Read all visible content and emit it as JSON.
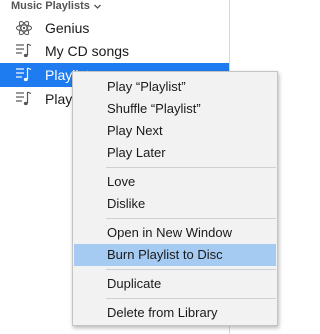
{
  "sidebar": {
    "section_title": "Music Playlists",
    "items": [
      {
        "label": "Genius",
        "icon": "genius-atom-icon"
      },
      {
        "label": "My CD songs",
        "icon": "playlist-icon"
      },
      {
        "label": "Playlist",
        "icon": "playlist-icon",
        "selected": true
      },
      {
        "label": "Playlist",
        "icon": "playlist-icon"
      }
    ]
  },
  "context_menu": {
    "items": [
      {
        "label": "Play “Playlist”"
      },
      {
        "label": "Shuffle “Playlist”"
      },
      {
        "label": "Play Next"
      },
      {
        "label": "Play Later"
      },
      {
        "label": "Love"
      },
      {
        "label": "Dislike"
      },
      {
        "label": "Open in New Window"
      },
      {
        "label": "Burn Playlist to Disc",
        "highlighted": true
      },
      {
        "label": "Duplicate"
      },
      {
        "label": "Delete from Library"
      }
    ]
  },
  "colors": {
    "selection_blue": "#1e7bf0",
    "menu_highlight": "#a6cbf2",
    "menu_background": "#f2f2f2"
  }
}
